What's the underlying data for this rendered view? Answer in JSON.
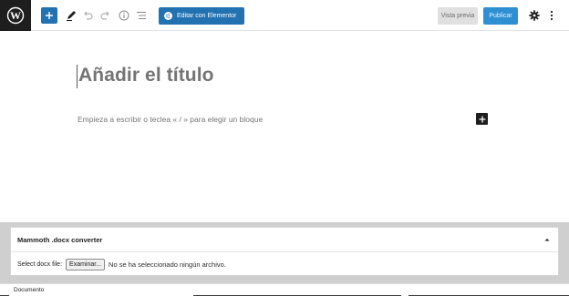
{
  "toolbar": {
    "wordpress_logo": "wordpress-logo",
    "add_block_icon": "plus-icon",
    "tools_icon": "pencil-icon",
    "undo_icon": "undo-icon",
    "redo_icon": "redo-icon",
    "info_icon": "info-icon",
    "list_view_icon": "list-view-icon",
    "elementor_label": "Editar con Elementor",
    "preview_label": "Vista previa",
    "publish_label": "Publicar",
    "settings_icon": "gear-icon",
    "options_icon": "kebab-icon",
    "colors": {
      "logo_bg": "#1e1e1e",
      "primary": "#2271b1",
      "publish_bg": "#2f8fd3",
      "preview_bg": "#e0e0e0"
    }
  },
  "editor": {
    "title_placeholder": "Añadir el título",
    "block_placeholder": "Empieza a escribir o teclea « / » para elegir un bloque",
    "block_add_icon": "plus-icon"
  },
  "metabox": {
    "title": "Mammoth .docx converter",
    "toggle_icon": "chevron-up-icon",
    "file_label": "Select docx file:",
    "browse_label": "Examinar...",
    "no_file_text": "No se ha seleccionado ningún archivo."
  },
  "footer": {
    "label": "Documento"
  }
}
